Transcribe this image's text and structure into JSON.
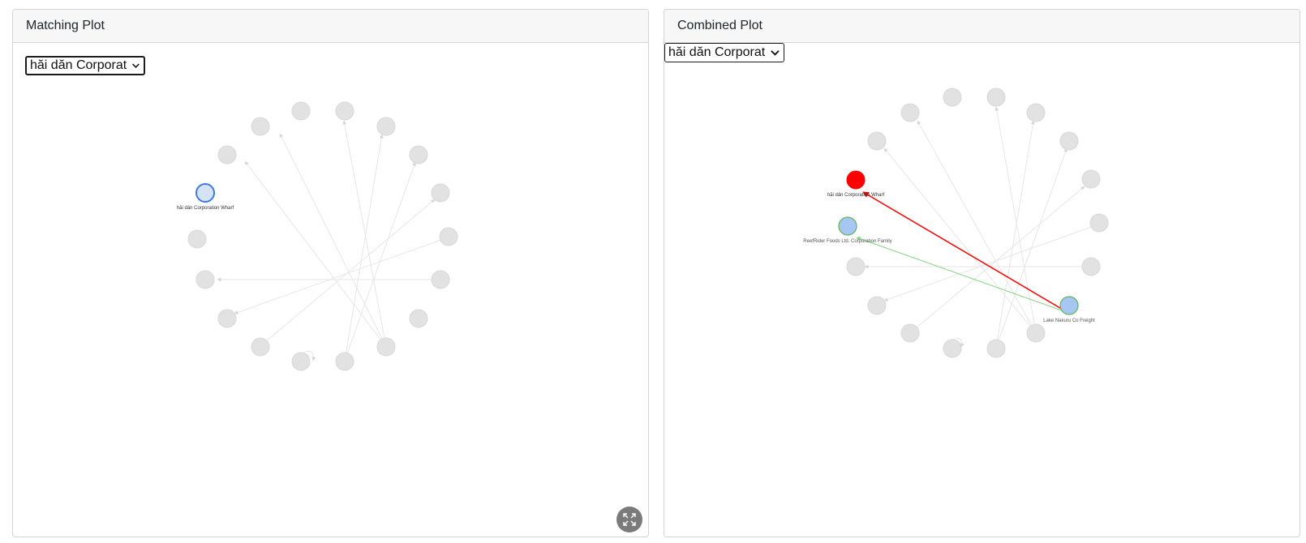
{
  "panels": {
    "matching": {
      "title": "Matching Plot",
      "dropdown": {
        "selected": "hăi dăn Corporat"
      },
      "labels": {
        "focus": "hăi dǎn Corporation Wharf"
      }
    },
    "combined": {
      "title": "Combined Plot",
      "dropdown": {
        "selected": "hăi dăn Corporat"
      },
      "labels": {
        "red_node": "hăi dǎn Corporation Wharf",
        "green_node": "ReefRider Foods Ltd. Corporation Family",
        "source_node": "Lake Nakuru  Co Freight"
      }
    }
  },
  "icons": {
    "dropdown": "chevron-down-icon",
    "fullscreen": "expand-icon"
  },
  "colors": {
    "node_grey": "#e2e2e2",
    "edge_grey": "#e0e0e0",
    "node_blue": "#a7c7f2",
    "node_blue_border_focus": "#3b7be0",
    "node_blue_border_green": "#5fb55f",
    "node_red": "#ff0000",
    "edge_red": "#ff0000",
    "edge_green": "#7fd07f"
  }
}
